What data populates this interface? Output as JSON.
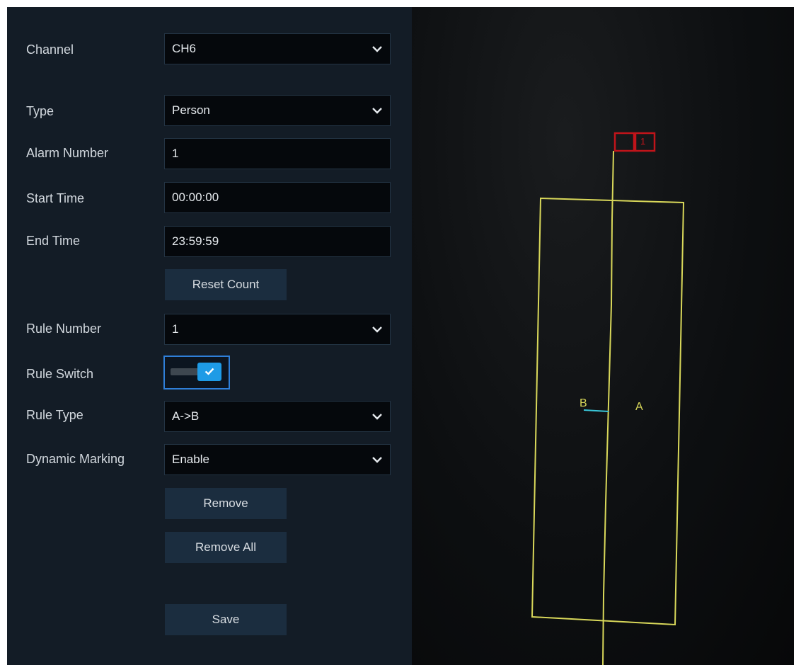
{
  "form": {
    "channel": {
      "label": "Channel",
      "value": "CH6"
    },
    "type": {
      "label": "Type",
      "value": "Person"
    },
    "alarm_number": {
      "label": "Alarm Number",
      "value": "1"
    },
    "start_time": {
      "label": "Start Time",
      "value": "00:00:00"
    },
    "end_time": {
      "label": "End Time",
      "value": "23:59:59"
    },
    "reset_count_label": "Reset Count",
    "rule_number": {
      "label": "Rule Number",
      "value": "1"
    },
    "rule_switch": {
      "label": "Rule Switch",
      "enabled": true
    },
    "rule_type": {
      "label": "Rule Type",
      "value": "A->B"
    },
    "dynamic_marking": {
      "label": "Dynamic Marking",
      "value": "Enable"
    },
    "remove_label": "Remove",
    "remove_all_label": "Remove All",
    "save_label": "Save"
  },
  "video": {
    "side_a_label": "A",
    "side_b_label": "B",
    "handle_label": "1",
    "zone_color": "#d9d85a",
    "handle_color": "#c0141a",
    "direction_color": "#39c6d8"
  },
  "colors": {
    "panel_bg": "#131c26",
    "field_bg": "#05080c",
    "button_bg": "#1b2d3f",
    "toggle_accent": "#1e9be6",
    "focus_border": "#2f7fd9"
  }
}
